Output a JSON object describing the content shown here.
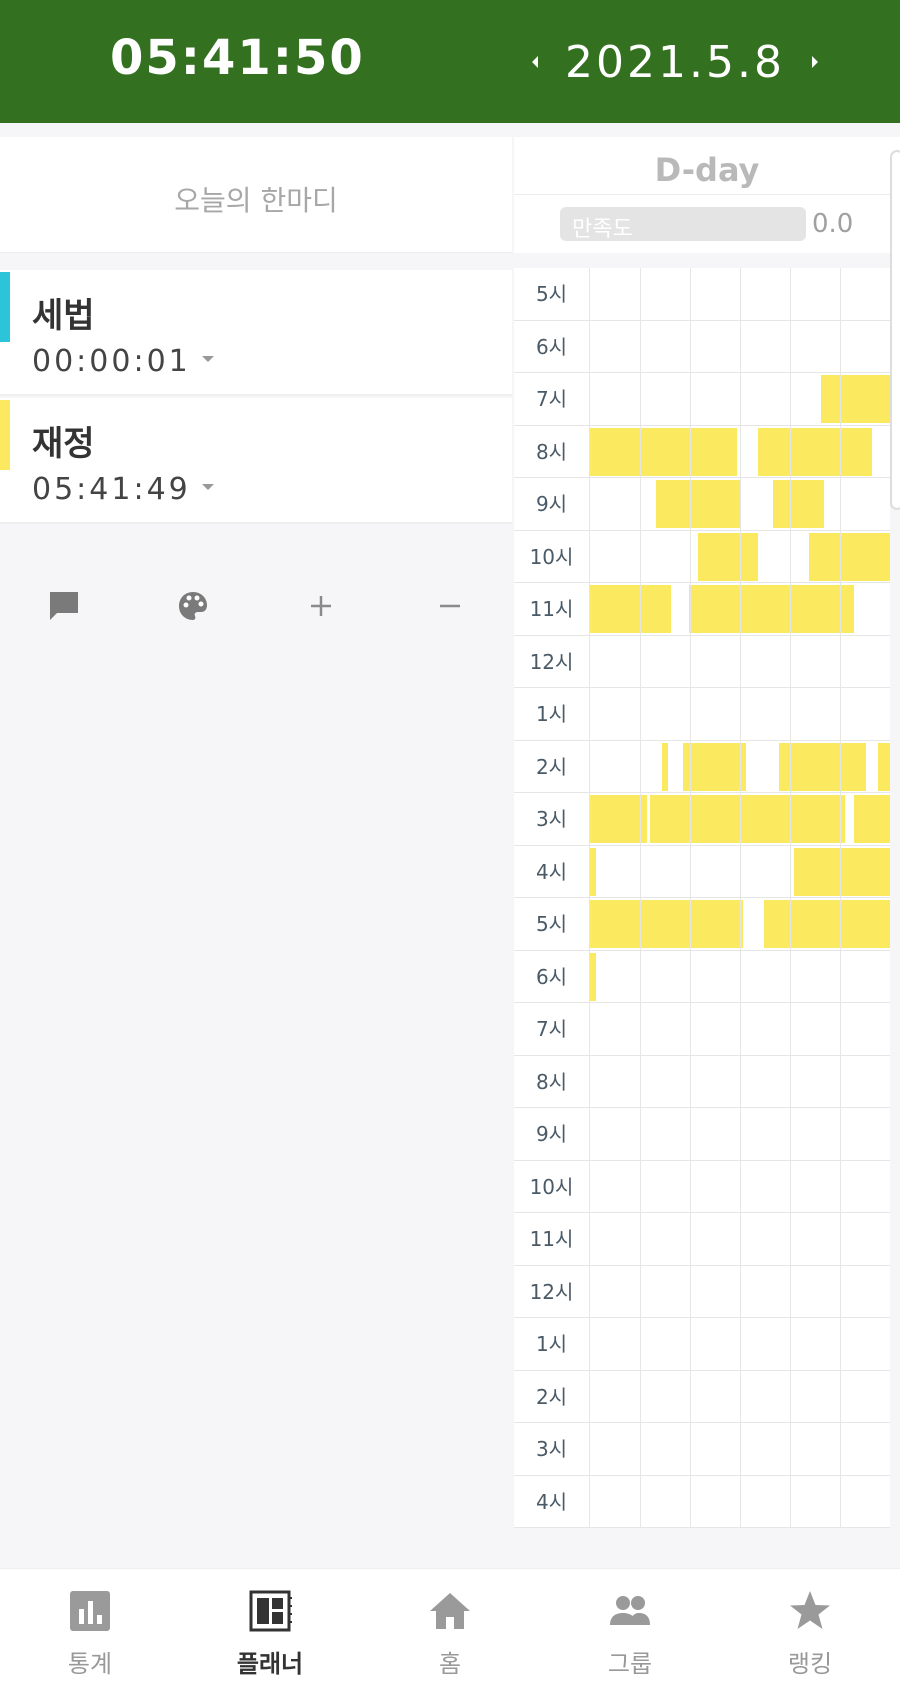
{
  "header": {
    "clock": "05:41:50",
    "date": "2021.5.8",
    "bg_color": "#33701f"
  },
  "motto": {
    "placeholder": "오늘의 한마디"
  },
  "dday": {
    "title": "D-day",
    "satisfaction_label": "만족도",
    "satisfaction_value": "0.0"
  },
  "subjects": [
    {
      "name": "세법",
      "time": "00:00:01",
      "color": "#2bc4d8"
    },
    {
      "name": "재정",
      "time": "05:41:49",
      "color": "#fbea60"
    }
  ],
  "tools": [
    {
      "icon": "comment-icon",
      "label": "comment"
    },
    {
      "icon": "palette-icon",
      "label": "palette"
    },
    {
      "icon": "plus-icon",
      "label": "+"
    },
    {
      "icon": "minus-icon",
      "label": "−"
    }
  ],
  "timetable": {
    "hours": [
      "5시",
      "6시",
      "7시",
      "8시",
      "9시",
      "10시",
      "11시",
      "12시",
      "1시",
      "2시",
      "3시",
      "4시",
      "5시",
      "6시",
      "7시",
      "8시",
      "9시",
      "10시",
      "11시",
      "12시",
      "1시",
      "2시",
      "3시",
      "4시"
    ],
    "fill_color": "#fbea60",
    "filled": [
      {
        "row": 2,
        "from": 0.77,
        "to": 1.0
      },
      {
        "row": 3,
        "from": 0.0,
        "to": 0.49
      },
      {
        "row": 3,
        "from": 0.56,
        "to": 0.94
      },
      {
        "row": 4,
        "from": 0.22,
        "to": 0.5
      },
      {
        "row": 4,
        "from": 0.61,
        "to": 0.78
      },
      {
        "row": 5,
        "from": 0.36,
        "to": 0.56
      },
      {
        "row": 5,
        "from": 0.73,
        "to": 1.0
      },
      {
        "row": 6,
        "from": 0.0,
        "to": 0.27
      },
      {
        "row": 6,
        "from": 0.33,
        "to": 0.88
      },
      {
        "row": 9,
        "from": 0.24,
        "to": 0.26
      },
      {
        "row": 9,
        "from": 0.31,
        "to": 0.52
      },
      {
        "row": 9,
        "from": 0.63,
        "to": 0.92
      },
      {
        "row": 9,
        "from": 0.96,
        "to": 1.0
      },
      {
        "row": 10,
        "from": 0.0,
        "to": 0.19
      },
      {
        "row": 10,
        "from": 0.2,
        "to": 0.85
      },
      {
        "row": 10,
        "from": 0.88,
        "to": 1.0
      },
      {
        "row": 11,
        "from": 0.0,
        "to": 0.02
      },
      {
        "row": 11,
        "from": 0.68,
        "to": 1.0
      },
      {
        "row": 12,
        "from": 0.0,
        "to": 0.51
      },
      {
        "row": 12,
        "from": 0.58,
        "to": 1.0
      },
      {
        "row": 13,
        "from": 0.0,
        "to": 0.02
      }
    ]
  },
  "nav": [
    {
      "label": "통계",
      "icon": "stats-icon",
      "active": false
    },
    {
      "label": "플래너",
      "icon": "planner-icon",
      "active": true
    },
    {
      "label": "홈",
      "icon": "home-icon",
      "active": false
    },
    {
      "label": "그룹",
      "icon": "group-icon",
      "active": false
    },
    {
      "label": "랭킹",
      "icon": "star-icon",
      "active": false
    }
  ]
}
